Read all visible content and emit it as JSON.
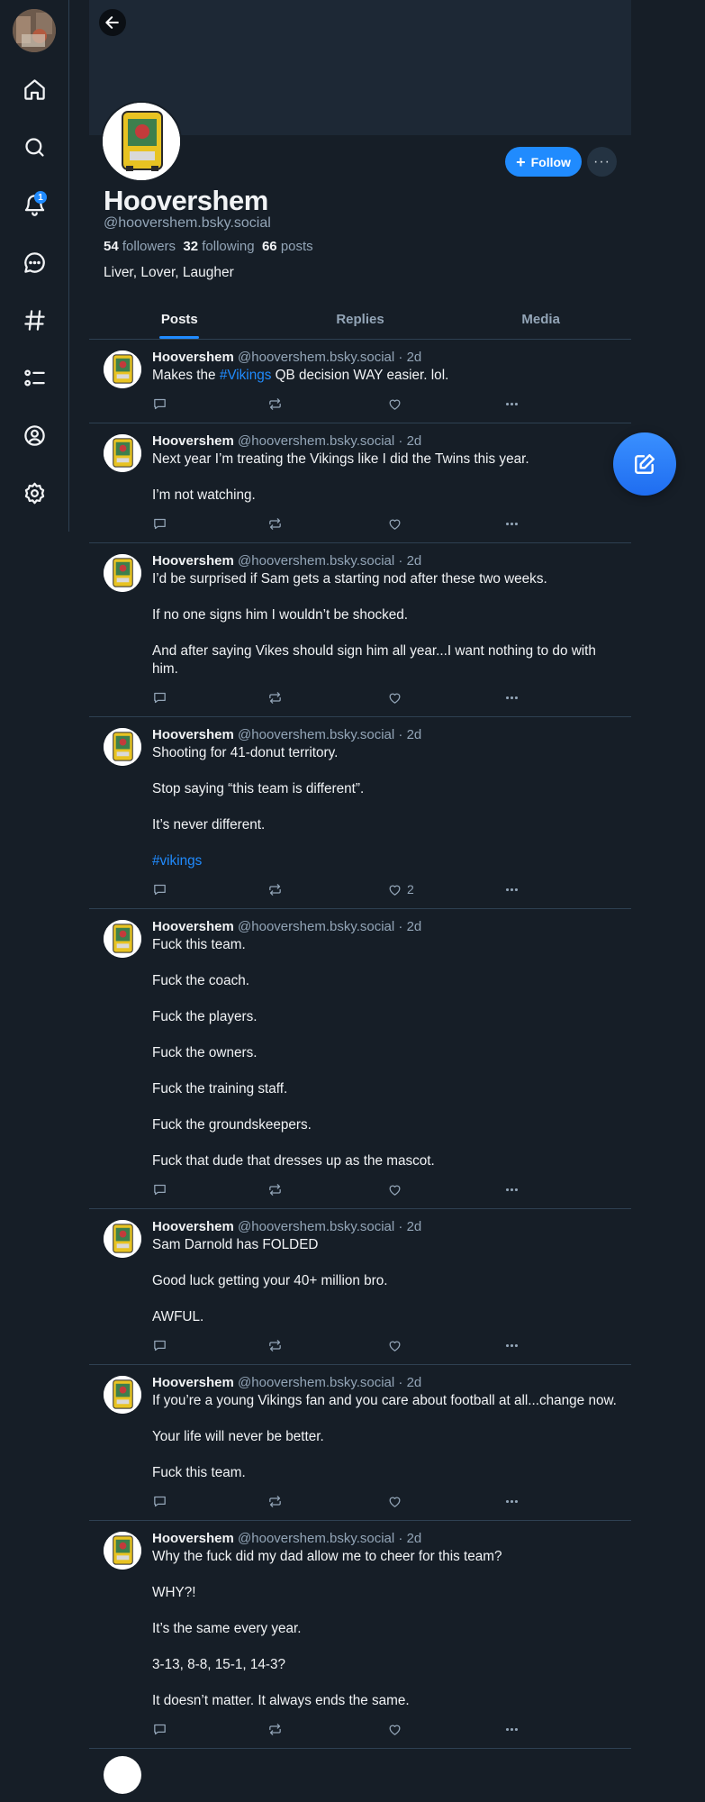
{
  "nav": {
    "notification_count": "1",
    "items": [
      "home",
      "search",
      "notifications",
      "chat",
      "feeds",
      "lists",
      "profile",
      "settings"
    ]
  },
  "profile": {
    "display_name": "Hoovershem",
    "handle": "@hoovershem.bsky.social",
    "followers_count": "54",
    "followers_label": "followers",
    "following_count": "32",
    "following_label": "following",
    "posts_count": "66",
    "posts_label": "posts",
    "bio": "Liver, Lover, Laugher",
    "follow_label": "Follow",
    "more_label": "···"
  },
  "tabs": [
    {
      "label": "Posts",
      "active": true
    },
    {
      "label": "Replies",
      "active": false
    },
    {
      "label": "Media",
      "active": false
    }
  ],
  "posts": [
    {
      "name": "Hoovershem",
      "handle": "@hoovershem.bsky.social",
      "time": "· 2d",
      "paragraphs": [
        [
          "Makes the ",
          {
            "tag": "#Vikings"
          },
          " QB decision WAY easier. lol."
        ]
      ],
      "likes": ""
    },
    {
      "name": "Hoovershem",
      "handle": "@hoovershem.bsky.social",
      "time": "· 2d",
      "paragraphs": [
        "Next year I’m treating the Vikings like I did the Twins this year.",
        "I’m not watching."
      ],
      "likes": ""
    },
    {
      "name": "Hoovershem",
      "handle": "@hoovershem.bsky.social",
      "time": "· 2d",
      "paragraphs": [
        "I’d be surprised if Sam gets a starting nod after these two weeks.",
        "If no one signs him I wouldn’t be shocked.",
        "And after saying Vikes should sign him all year...I want nothing to do with him."
      ],
      "likes": ""
    },
    {
      "name": "Hoovershem",
      "handle": "@hoovershem.bsky.social",
      "time": "· 2d",
      "paragraphs": [
        "Shooting for 41-donut territory.",
        "Stop saying “this team is different”.",
        "It’s never different.",
        [
          {
            "tag": "#vikings"
          }
        ]
      ],
      "likes": "2"
    },
    {
      "name": "Hoovershem",
      "handle": "@hoovershem.bsky.social",
      "time": "· 2d",
      "paragraphs": [
        "Fuck this team.",
        "Fuck the coach.",
        "Fuck the players.",
        "Fuck the owners.",
        "Fuck the training staff.",
        "Fuck the groundskeepers.",
        "Fuck that dude that dresses up as the mascot."
      ],
      "likes": ""
    },
    {
      "name": "Hoovershem",
      "handle": "@hoovershem.bsky.social",
      "time": "· 2d",
      "paragraphs": [
        "Sam Darnold has FOLDED",
        "Good luck getting your 40+ million bro.",
        "AWFUL."
      ],
      "likes": ""
    },
    {
      "name": "Hoovershem",
      "handle": "@hoovershem.bsky.social",
      "time": "· 2d",
      "paragraphs": [
        "If you’re a young Vikings fan and you care about football at all...change now.",
        "Your life will never be better.",
        "Fuck this team."
      ],
      "likes": ""
    },
    {
      "name": "Hoovershem",
      "handle": "@hoovershem.bsky.social",
      "time": "· 2d",
      "paragraphs": [
        "Why the fuck did my dad allow me to cheer for this team?",
        "WHY?!",
        "It’s the same every year.",
        "3-13, 8-8, 15-1, 14-3?",
        "It doesn’t matter. It always ends the same."
      ],
      "likes": ""
    }
  ],
  "colors": {
    "background": "#161e27",
    "accent": "#208bfe",
    "muted_text": "#93a5b7",
    "border": "#2e4052"
  }
}
